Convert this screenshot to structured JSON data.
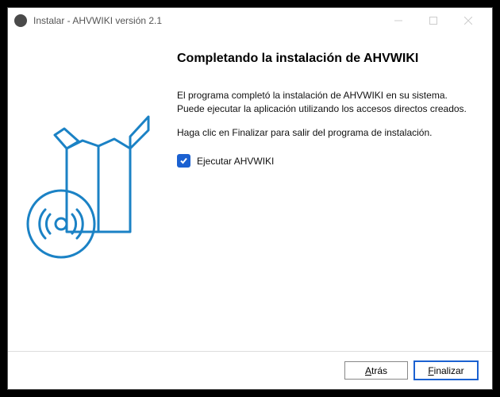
{
  "window": {
    "title": "Instalar - AHVWIKI versión 2.1"
  },
  "main": {
    "heading": "Completando la instalación de AHVWIKI",
    "paragraph1": "El programa completó la instalación de AHVWIKI en su sistema. Puede ejecutar la aplicación utilizando los accesos directos creados.",
    "paragraph2": "Haga clic en Finalizar para salir del programa de instalación.",
    "checkbox": {
      "checked": true,
      "label": "Ejecutar AHVWIKI"
    }
  },
  "buttons": {
    "back": "Atrás",
    "back_accesskey": "A",
    "finish": "Finalizar",
    "finish_accesskey": "F"
  }
}
